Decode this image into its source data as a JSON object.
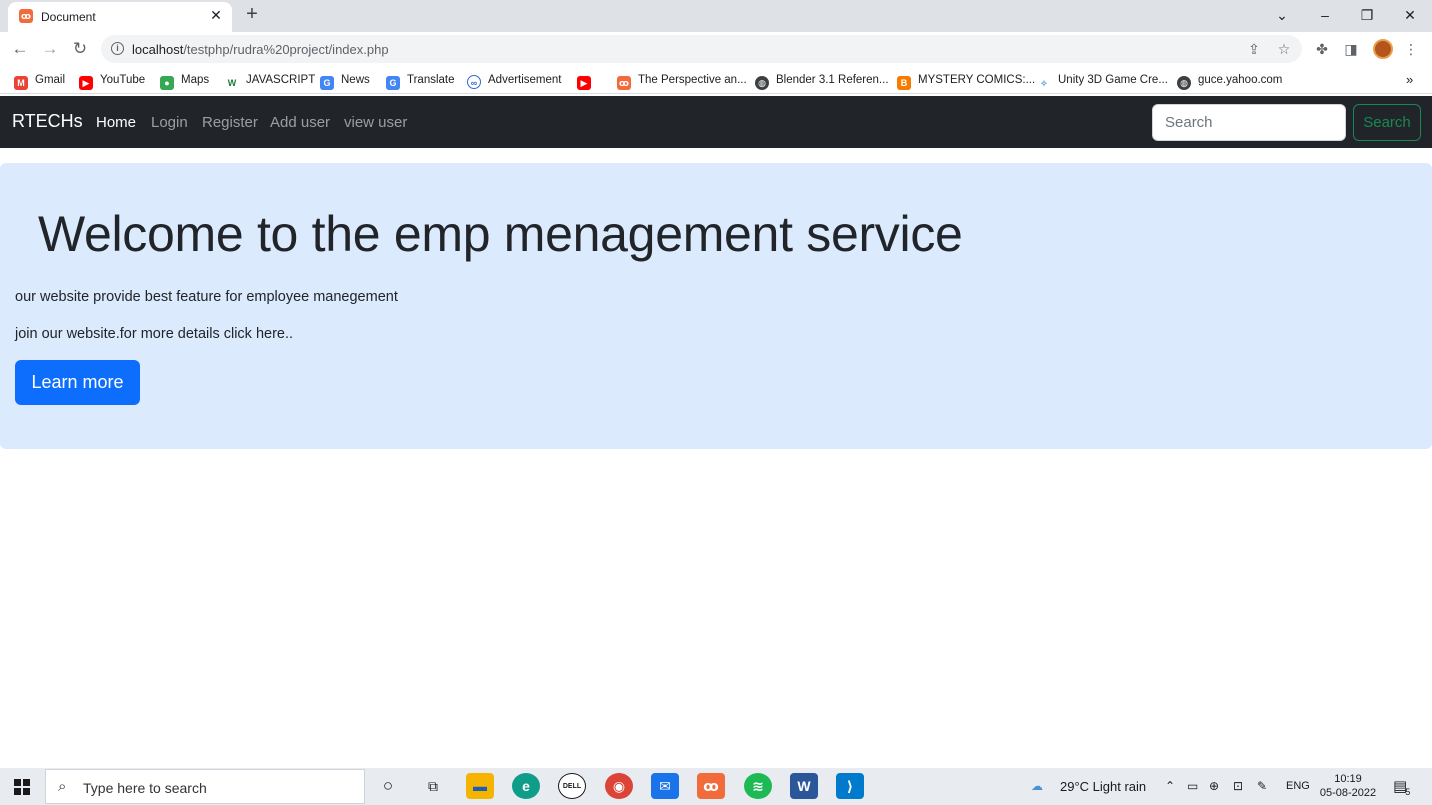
{
  "browser": {
    "tab_title": "Document",
    "url_host": "localhost",
    "url_path": "/testphp/rudra%20project/index.php"
  },
  "bookmarks": [
    {
      "label": "Gmail",
      "icon": "gmail-icon",
      "color": "#ea4335"
    },
    {
      "label": "YouTube",
      "icon": "youtube-icon",
      "color": "#ff0000"
    },
    {
      "label": "Maps",
      "icon": "maps-icon",
      "color": "#34a853"
    },
    {
      "label": "JAVASCRIPT",
      "icon": "w-icon",
      "color": "#1f7a3a"
    },
    {
      "label": "News",
      "icon": "news-icon",
      "color": "#4285f4"
    },
    {
      "label": "Translate",
      "icon": "translate-icon",
      "color": "#4285f4"
    },
    {
      "label": "Advertisement",
      "icon": "ad-icon",
      "color": "#3367d6"
    },
    {
      "label": "",
      "icon": "youtube-icon",
      "color": "#ff0000"
    },
    {
      "label": "The Perspective an...",
      "icon": "xampp-icon",
      "color": "#f26b3a"
    },
    {
      "label": "Blender 3.1 Referen...",
      "icon": "globe-icon",
      "color": "#3c4043"
    },
    {
      "label": "MYSTERY COMICS:...",
      "icon": "blogger-icon",
      "color": "#f57c00"
    },
    {
      "label": "Unity 3D Game Cre...",
      "icon": "unity-icon",
      "color": "#6aa9d8"
    },
    {
      "label": "guce.yahoo.com",
      "icon": "globe-icon",
      "color": "#3c4043"
    }
  ],
  "navbar": {
    "brand": "RTECHs",
    "links": [
      "Home",
      "Login",
      "Register",
      "Add user",
      "view user"
    ],
    "search_placeholder": "Search",
    "search_button": "Search"
  },
  "hero": {
    "title": "Welcome to the emp menagement service",
    "line1": "our website provide best feature for employee manegement",
    "line2": "join our website.for more details click here..",
    "button": "Learn more"
  },
  "taskbar": {
    "search_placeholder": "Type here to search",
    "weather": "29°C  Light rain",
    "language": "ENG",
    "time": "10:19",
    "date": "05-08-2022",
    "notification_count": "5"
  }
}
